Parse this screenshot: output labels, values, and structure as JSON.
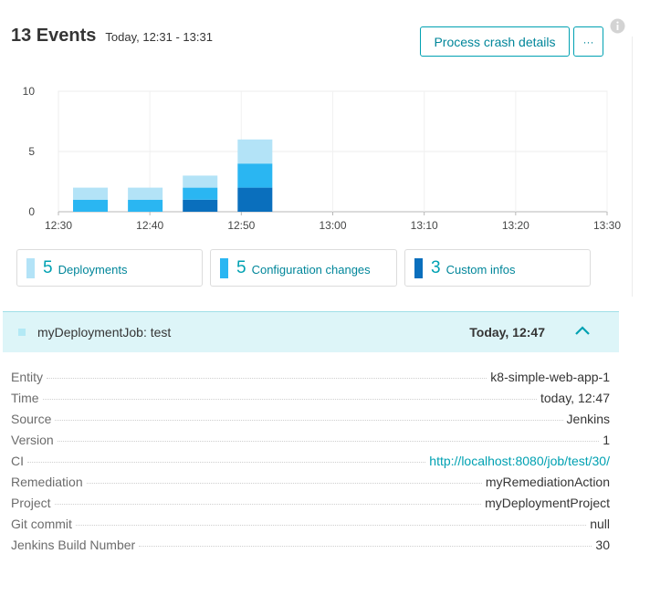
{
  "header": {
    "title": "13 Events",
    "subtitle": "Today, 12:31 - 13:31"
  },
  "toolbar": {
    "process_label": "Process crash details",
    "more_label": "···",
    "info_icon": "info-icon"
  },
  "colors": {
    "accent": "#00a1b2",
    "deployments": "#b3e3f7",
    "configuration": "#2ab6f2",
    "custom_infos": "#0a6fbd"
  },
  "chart_data": {
    "type": "bar",
    "stacked": true,
    "categories": [
      "12:31",
      "12:37",
      "12:43",
      "12:49"
    ],
    "series": [
      {
        "name": "Custom infos",
        "values": [
          0,
          0,
          1,
          2
        ]
      },
      {
        "name": "Configuration changes",
        "values": [
          1,
          1,
          1,
          2
        ]
      },
      {
        "name": "Deployments",
        "values": [
          1,
          1,
          1,
          2
        ]
      }
    ],
    "xticks": [
      "12:30",
      "12:40",
      "12:50",
      "13:00",
      "13:10",
      "13:20",
      "13:30"
    ],
    "yticks": [
      "0",
      "5",
      "10"
    ],
    "ylim": [
      0,
      10
    ],
    "grid": true
  },
  "legend": [
    {
      "count": "5",
      "label": "Deployments"
    },
    {
      "count": "5",
      "label": "Configuration changes"
    },
    {
      "count": "3",
      "label": "Custom infos"
    }
  ],
  "event": {
    "name": "myDeploymentJob: test",
    "time": "Today, 12:47"
  },
  "details": [
    {
      "key": "Entity",
      "value": "k8-simple-web-app-1"
    },
    {
      "key": "Time",
      "value": "today, 12:47"
    },
    {
      "key": "Source",
      "value": "Jenkins"
    },
    {
      "key": "Version",
      "value": "1"
    },
    {
      "key": "CI",
      "value": "http://localhost:8080/job/test/30/"
    },
    {
      "key": "Remediation",
      "value": "myRemediationAction"
    },
    {
      "key": "Project",
      "value": "myDeploymentProject"
    },
    {
      "key": "Git commit",
      "value": "null"
    },
    {
      "key": "Jenkins Build Number",
      "value": "30"
    }
  ]
}
